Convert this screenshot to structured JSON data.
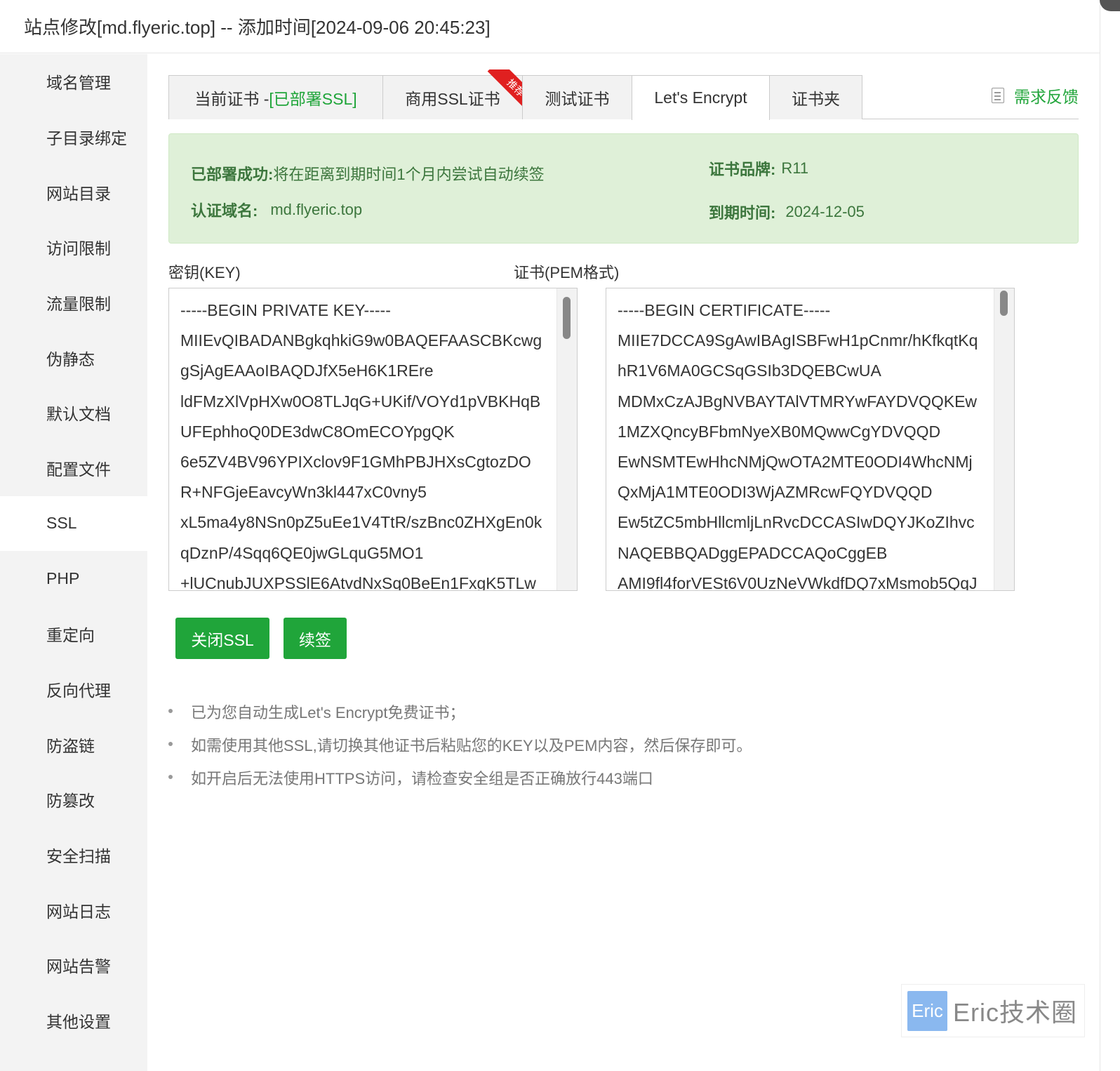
{
  "dialog": {
    "title": "站点修改[md.flyeric.top] -- 添加时间[2024-09-06 20:45:23]",
    "close_icon": "close-icon"
  },
  "sidebar": {
    "items": [
      {
        "label": "域名管理"
      },
      {
        "label": "子目录绑定"
      },
      {
        "label": "网站目录"
      },
      {
        "label": "访问限制"
      },
      {
        "label": "流量限制"
      },
      {
        "label": "伪静态"
      },
      {
        "label": "默认文档"
      },
      {
        "label": "配置文件"
      },
      {
        "label": "SSL",
        "active": true
      },
      {
        "label": "PHP"
      },
      {
        "label": "重定向"
      },
      {
        "label": "反向代理"
      },
      {
        "label": "防盗链"
      },
      {
        "label": "防篡改"
      },
      {
        "label": "安全扫描"
      },
      {
        "label": "网站日志"
      },
      {
        "label": "网站告警"
      },
      {
        "label": "其他设置"
      }
    ]
  },
  "tabs": {
    "current_prefix": "当前证书 - ",
    "current_status": "[已部署SSL]",
    "commercial": "商用SSL证书",
    "ribbon": "推荐",
    "test": "测试证书",
    "letsencrypt": "Let's Encrypt",
    "folder": "证书夹",
    "active": "letsencrypt"
  },
  "feedback": {
    "label": "需求反馈",
    "icon": "edit-note-icon"
  },
  "status": {
    "deploy_label": "已部署成功:",
    "deploy_value": "将在距离到期时间1个月内尝试自动续签",
    "domain_label": "认证域名:",
    "domain_value": "md.flyeric.top",
    "brand_label": "证书品牌:",
    "brand_value": "R11",
    "expire_label": "到期时间:",
    "expire_value": "2024-12-05"
  },
  "fields": {
    "key_label": "密钥(KEY)",
    "cert_label": "证书(PEM格式)",
    "key_lines": [
      "-----BEGIN PRIVATE KEY-----",
      "MIIEvQIBADANBgkqhkiG9w0BAQEFAASCBKcwg",
      "gSjAgEAAoIBAQDJfX5eH6K1REre",
      "ldFMzXlVpHXw0O8TLJqG+UKif/VOYd1pVBKHqB",
      "UFEphhoQ0DE3dwC8OmECOYpgQK",
      "6e5ZV4BV96YPIXclov9F1GMhPBJHXsCgtozDO",
      "R+NFGjeEavcyWn3kl447xC0vny5",
      "xL5ma4y8NSn0pZ5uEe1V4TtR/szBnc0ZHXgEn0k",
      "qDznP/4Sqq6QE0jwGLquG5MO1",
      "+lUCnubJUXPSSlE6AtvdNxSq0BeEn1FxgK5TLw"
    ],
    "cert_lines": [
      "-----BEGIN CERTIFICATE-----",
      "MIIE7DCCA9SgAwIBAgISBFwH1pCnmr/hKfkqtKq",
      "hR1V6MA0GCSqGSIb3DQEBCwUA",
      "MDMxCzAJBgNVBAYTAlVTMRYwFAYDVQQKEw",
      "1MZXQncyBFbmNyeXB0MQwwCgYDVQQD",
      "EwNSMTEwHhcNMjQwOTA2MTE0ODI4WhcNMj",
      "QxMjA1MTE0ODI3WjAZMRcwFQYDVQQD",
      "Ew5tZC5mbHllcmljLnRvcDCCASIwDQYJKoZIhvc",
      "NAQEBBQADggEPADCCAQoCggEB",
      "AMI9fl4forVESt6V0UzNeVWkdfDQ7xMsmob5QqJ"
    ]
  },
  "buttons": {
    "close_ssl": "关闭SSL",
    "renew": "续签"
  },
  "tips": [
    "已为您自动生成Let's Encrypt免费证书；",
    "如需使用其他SSL,请切换其他证书后粘贴您的KEY以及PEM内容，然后保存即可。",
    "如开启后无法使用HTTPS访问，请检查安全组是否正确放行443端口"
  ],
  "watermark": {
    "logo": "Eric",
    "text": "Eric技术圈"
  },
  "colors": {
    "accent": "#20a53a",
    "success_bg": "#dff0d8",
    "success_text": "#3c763d",
    "ribbon": "#e02020"
  }
}
